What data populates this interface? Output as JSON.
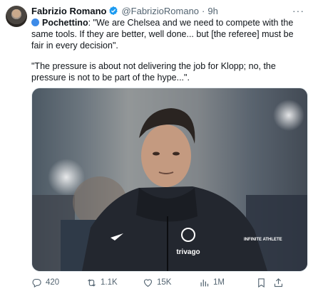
{
  "tweet": {
    "author_name": "Fabrizio Romano",
    "author_handle": "@FabrizioRomano",
    "separator": "·",
    "time": "9h",
    "more": "···",
    "para1_lead": "Pochettino",
    "para1_rest": ": \"We are Chelsea and we need to compete with the same tools. If they are better, well done... but [the referee] must be fair in every decision\".",
    "para2": "\"The pressure is about not delivering the job for Klopp; no, the pressure is not to be part of the hype...\".",
    "photo_text": {
      "sponsor": "trivago",
      "kit_mark": "INFINITE ATHLETE"
    }
  },
  "actions": {
    "replies": "420",
    "reposts": "1.1K",
    "likes": "15K",
    "views": "1M"
  },
  "colors": {
    "verified": "#1d9bf0",
    "secondary_text": "#536471",
    "flag": "#3d8be8"
  },
  "icons": [
    "verified-badge-icon",
    "flag-icon",
    "reply-icon",
    "repost-icon",
    "like-icon",
    "views-icon",
    "bookmark-icon",
    "share-icon",
    "more-icon"
  ]
}
